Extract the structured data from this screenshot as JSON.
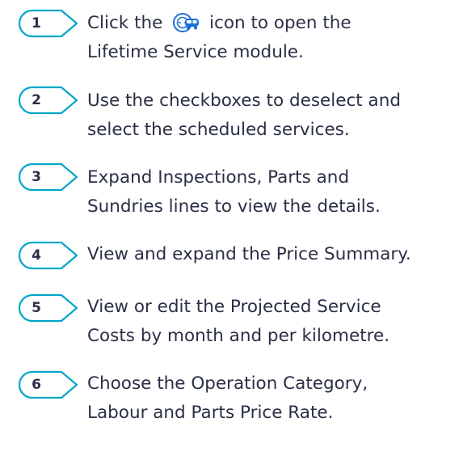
{
  "colors": {
    "badge_stroke": "#00a7c8",
    "text": "#2a2f45",
    "icon_blue": "#1b6fd9"
  },
  "steps": [
    {
      "number": "1",
      "pre_icon": "Click the",
      "icon": "lifetime-service-icon",
      "line1_rest": "icon to open the",
      "line2": "Lifetime Service module."
    },
    {
      "number": "2",
      "line1": "Use the checkboxes to deselect and",
      "line2": "select the scheduled services."
    },
    {
      "number": "3",
      "line1": "Expand Inspections, Parts and",
      "line2": "Sundries lines to view the details."
    },
    {
      "number": "4",
      "line1": "View and expand the Price Summary."
    },
    {
      "number": "5",
      "line1": "View or edit the Projected Service",
      "line2": "Costs by month and per kilometre."
    },
    {
      "number": "6",
      "line1": "Choose the Operation Category,",
      "line2": "Labour and Parts Price Rate."
    }
  ]
}
